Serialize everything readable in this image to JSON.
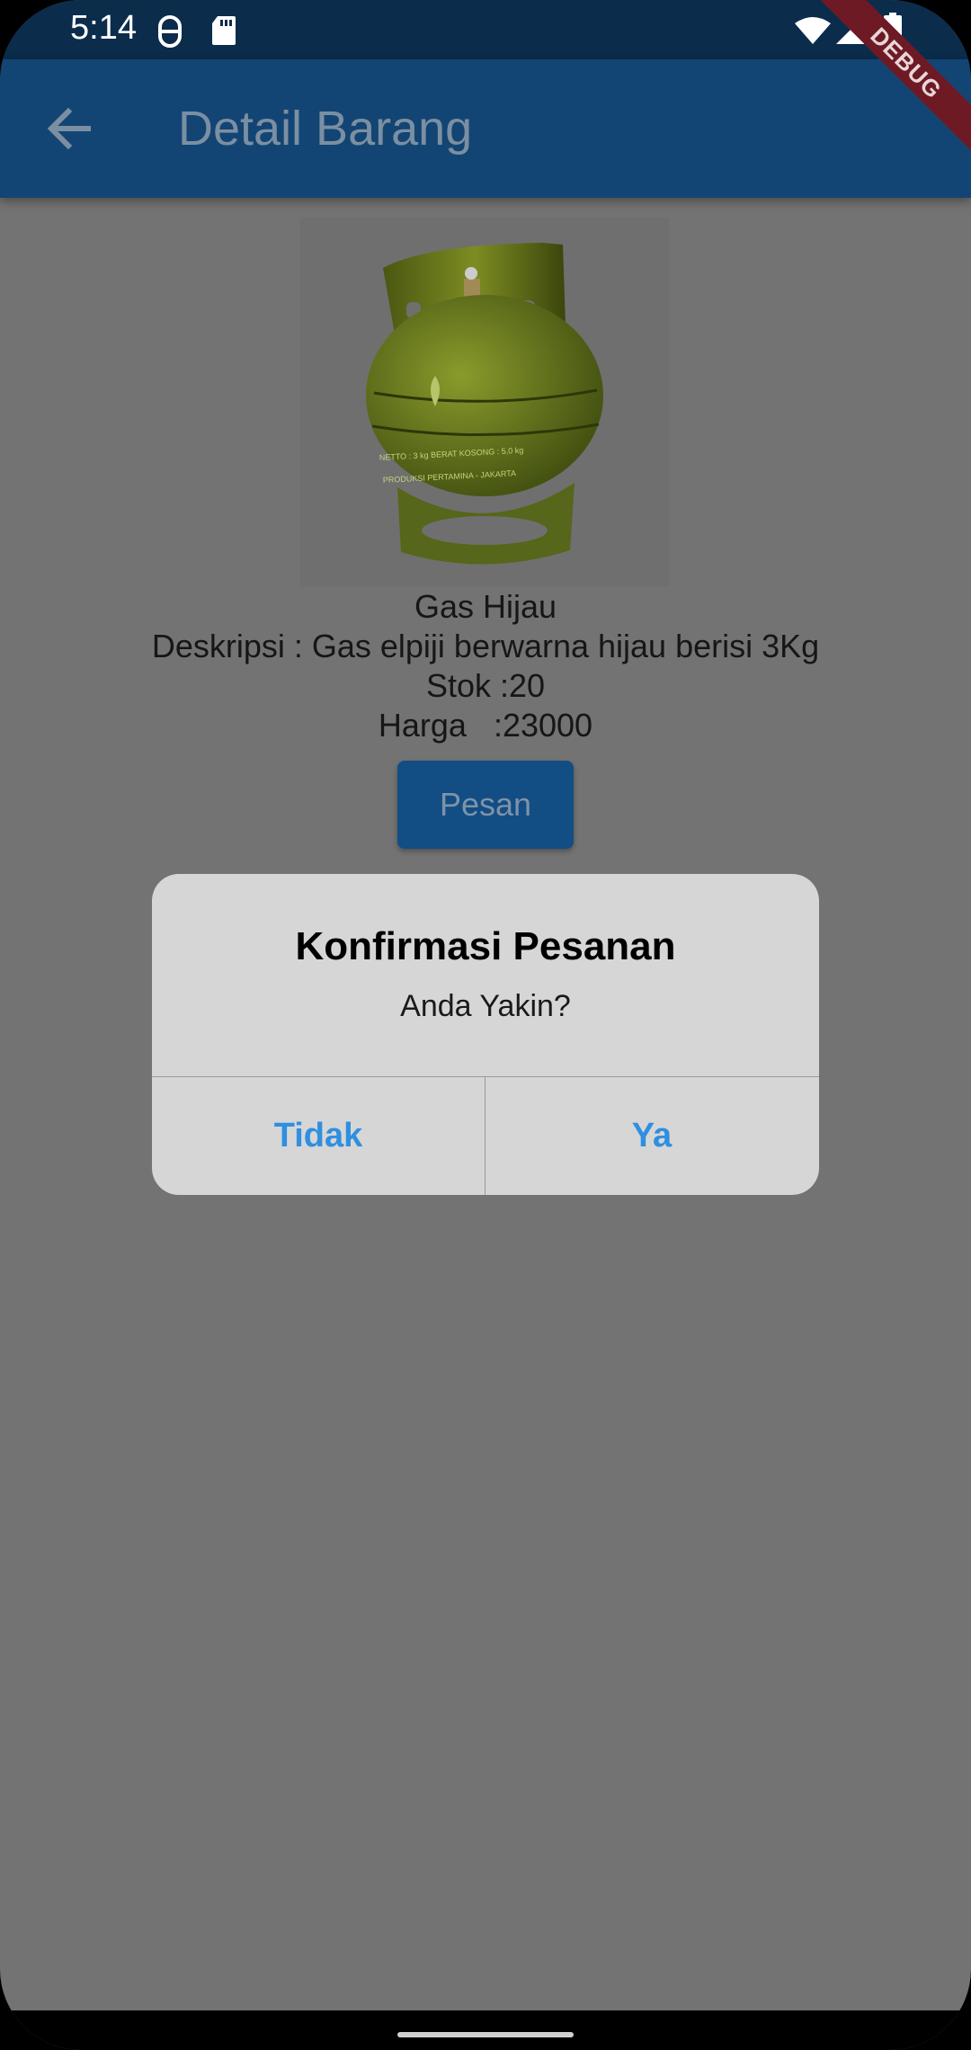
{
  "status_bar": {
    "time": "5:14",
    "icons": [
      "vpn-key-icon",
      "sd-card-icon",
      "wifi-icon",
      "signal-icon",
      "battery-icon"
    ]
  },
  "app_bar": {
    "title": "Detail Barang",
    "back_icon": "arrow-back-icon",
    "debug_banner": "DEBUG"
  },
  "product": {
    "image_icon": "gas-cylinder-image",
    "cylinder_text_1": "NETTO : 3 kg  BERAT KOSONG : 5,0 kg",
    "cylinder_text_2": "PRODUKSI PERTAMINA - JAKARTA",
    "name": "Gas Hijau",
    "description": "Deskripsi : Gas elpiji berwarna hijau berisi 3Kg",
    "stock": "Stok :20",
    "price": "Harga   :23000",
    "order_button": "Pesan"
  },
  "dialog": {
    "title": "Konfirmasi Pesanan",
    "message": "Anda Yakin?",
    "cancel_label": "Tidak",
    "confirm_label": "Ya"
  },
  "colors": {
    "app_bar": "#124573",
    "status_bar": "#0c2c4c",
    "scrim_background": "#737373",
    "dialog_background": "#d6d6d6",
    "dialog_action": "#2f8fe0"
  }
}
